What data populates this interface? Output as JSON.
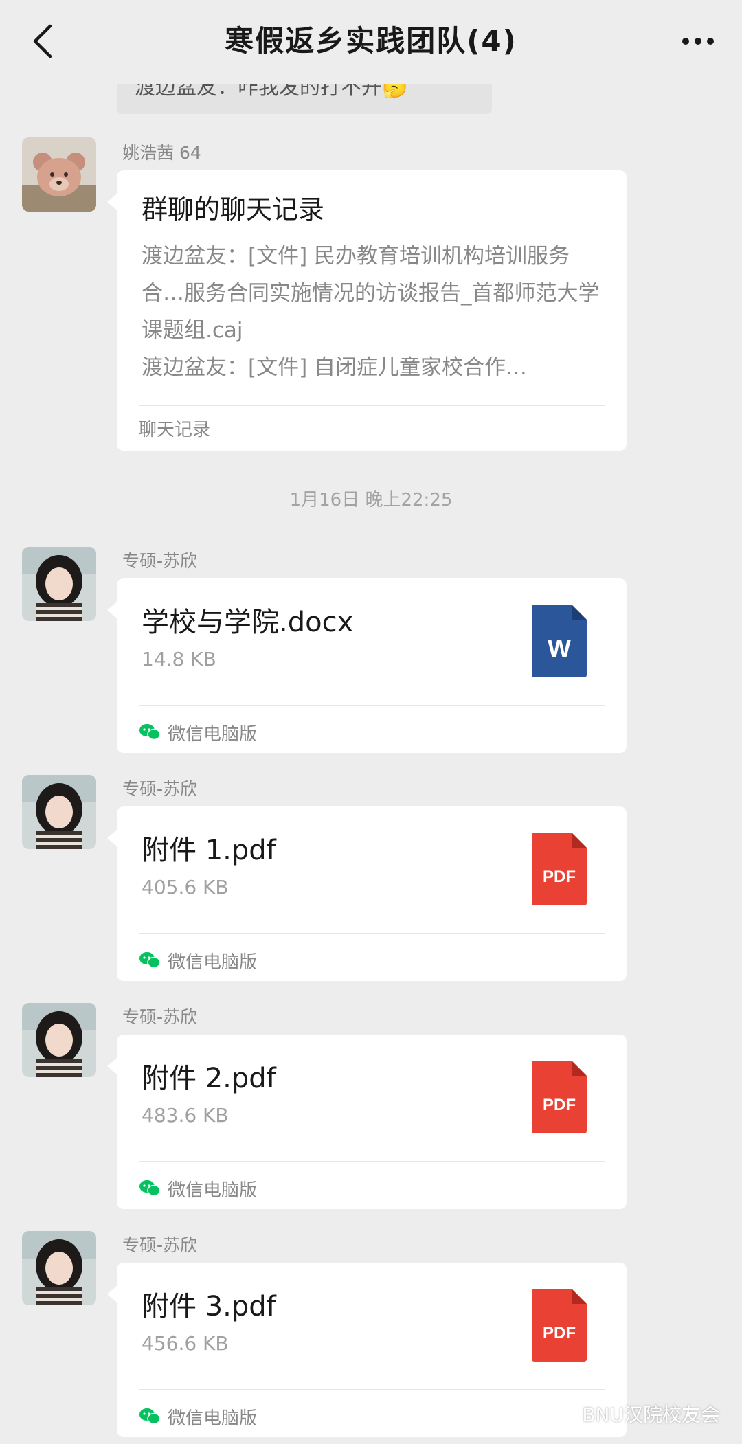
{
  "header": {
    "title": "寒假返乡实践团队(4)"
  },
  "quoted_message": {
    "text": "渡边盆友：咋我发的打不开🤔"
  },
  "messages": [
    {
      "sender": "姚浩茜 64",
      "avatar": "teddy-bear-avatar",
      "type": "chat_record",
      "record_title": "群聊的聊天记录",
      "record_lines": [
        "渡边盆友：[文件] 民办教育培训机构培训服务合…服务合同实施情况的访谈报告_首都师范大学课题组.caj",
        "渡边盆友：[文件] 自闭症儿童家校合作…"
      ],
      "footer": "聊天记录"
    },
    {
      "sender": "专硕-苏欣",
      "type": "file",
      "file_name": "学校与学院.docx",
      "file_size": "14.8 KB",
      "icon": "word-file-icon",
      "icon_label": "W",
      "footer": "微信电脑版"
    },
    {
      "sender": "专硕-苏欣",
      "type": "file",
      "file_name": "附件 1.pdf",
      "file_size": "405.6 KB",
      "icon": "pdf-file-icon",
      "icon_label": "PDF",
      "footer": "微信电脑版"
    },
    {
      "sender": "专硕-苏欣",
      "type": "file",
      "file_name": "附件 2.pdf",
      "file_size": "483.6 KB",
      "icon": "pdf-file-icon",
      "icon_label": "PDF",
      "footer": "微信电脑版"
    },
    {
      "sender": "专硕-苏欣",
      "type": "file",
      "file_name": "附件 3.pdf",
      "file_size": "456.6 KB",
      "icon": "pdf-file-icon",
      "icon_label": "PDF",
      "footer": "微信电脑版"
    }
  ],
  "timestamp": "1月16日 晚上22:25",
  "watermark": "BNU汉院校友会",
  "colors": {
    "background": "#ededed",
    "bubble": "#ffffff",
    "word_blue": "#2b579a",
    "pdf_red": "#e94235",
    "wechat_green": "#07c160"
  }
}
